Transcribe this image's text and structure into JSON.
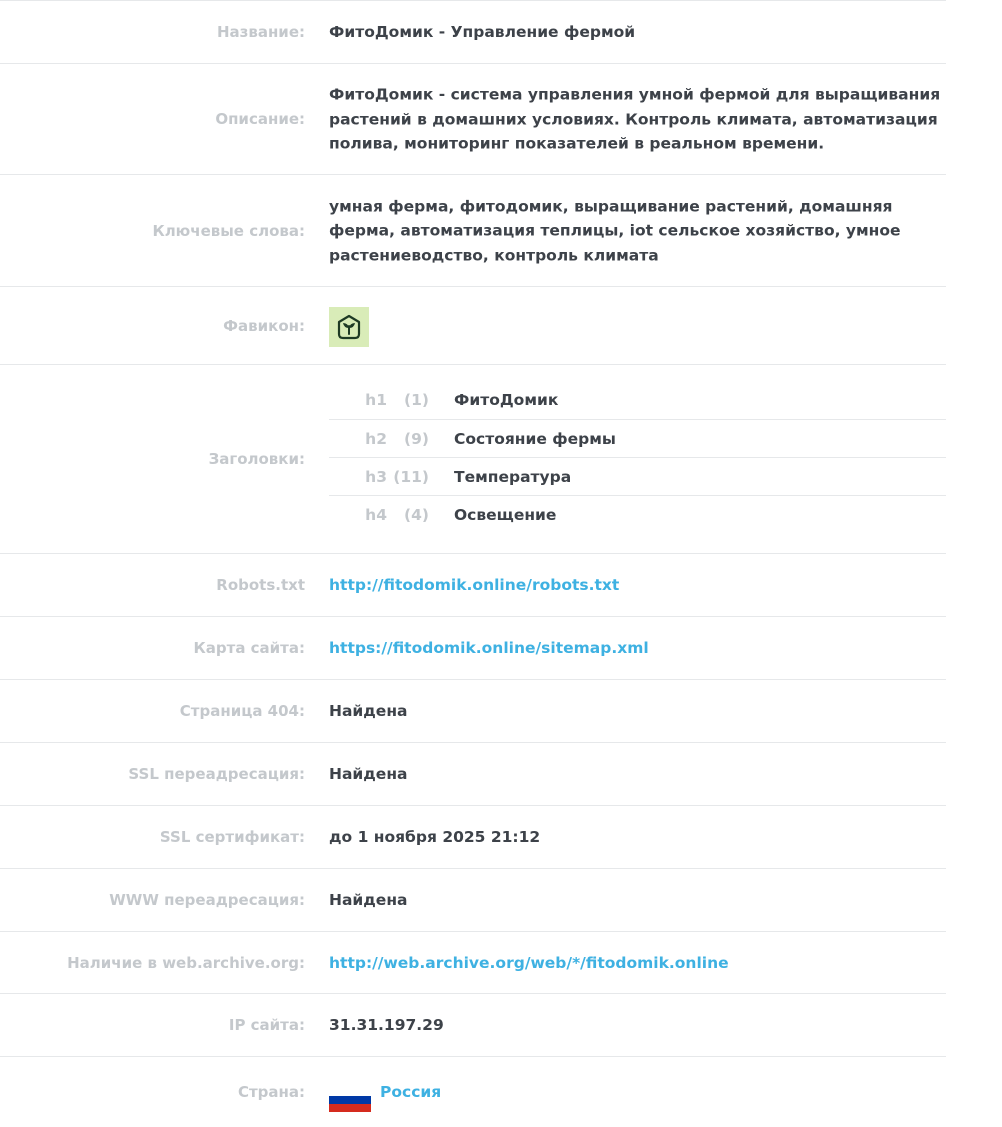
{
  "rows": {
    "title": {
      "label": "Название:",
      "value": "ФитоДомик - Управление фермой"
    },
    "description": {
      "label": "Описание:",
      "value": "ФитоДомик - система управления умной фермой для выращивания растений в домашних условиях. Контроль климата, автоматизация полива, мониторинг показателей в реальном времени."
    },
    "keywords": {
      "label": "Ключевые слова:",
      "value": "умная ферма, фитодомик, выращивание растений, домашняя ферма, автоматизация теплицы, iot сельское хозяйство, умное растениеводство, контроль климата"
    },
    "favicon": {
      "label": "Фавикон:",
      "icon": "sprout-house-icon",
      "bg_color": "#d9ecb8"
    },
    "headings": {
      "label": "Заголовки:",
      "items": [
        {
          "tag": "h1",
          "count": "(1)",
          "text": "ФитоДомик"
        },
        {
          "tag": "h2",
          "count": "(9)",
          "text": "Состояние фермы"
        },
        {
          "tag": "h3",
          "count": "(11)",
          "text": "Температура"
        },
        {
          "tag": "h4",
          "count": "(4)",
          "text": "Освещение"
        }
      ]
    },
    "robots": {
      "label": "Robots.txt",
      "value": "http://fitodomik.online/robots.txt"
    },
    "sitemap": {
      "label": "Карта сайта:",
      "value": "https://fitodomik.online/sitemap.xml"
    },
    "page404": {
      "label": "Страница 404:",
      "value": "Найдена"
    },
    "ssl_redirect": {
      "label": "SSL переадресация:",
      "value": "Найдена"
    },
    "ssl_cert": {
      "label": "SSL сертификат:",
      "value": "до 1 ноября 2025 21:12"
    },
    "www_redirect": {
      "label": "WWW переадресация:",
      "value": "Найдена"
    },
    "archive": {
      "label": "Наличие в web.archive.org:",
      "value": "http://web.archive.org/web/*/fitodomik.online"
    },
    "ip": {
      "label": "IP сайта:",
      "value": "31.31.197.29"
    },
    "country": {
      "label": "Страна:",
      "value": "Россия",
      "flag_colors": [
        "#ffffff",
        "#0039a6",
        "#d52b1e"
      ]
    }
  },
  "colors": {
    "label": "#c4c8cc",
    "value": "#3d4249",
    "link": "#3eb1e2",
    "border": "#e6e8ea"
  }
}
